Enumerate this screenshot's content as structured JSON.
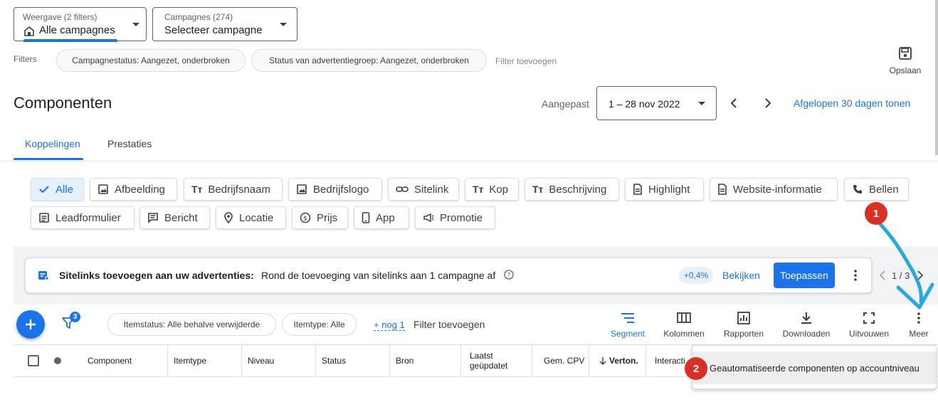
{
  "view_select": {
    "label": "Weergave (2 filters)",
    "value": "Alle campagnes"
  },
  "campaign_select": {
    "label": "Campagnes (274)",
    "value": "Selecteer campagne"
  },
  "filters": {
    "label": "Filters",
    "chips": [
      "Campagnestatus: Aangezet, onderbroken",
      "Status van advertentiegroep: Aangezet, onderbroken"
    ],
    "add": "Filter toevoegen"
  },
  "save_label": "Opslaan",
  "page_title": "Componenten",
  "date": {
    "label": "Aangepast",
    "range": "1 – 28 nov 2022",
    "show_30": "Afgelopen 30 dagen tonen"
  },
  "tabs": [
    "Koppelingen",
    "Prestaties"
  ],
  "asset_types": [
    "Alle",
    "Afbeelding",
    "Bedrijfsnaam",
    "Bedrijfslogo",
    "Sitelink",
    "Kop",
    "Beschrijving",
    "Highlight",
    "Website-informatie",
    "Bellen",
    "Leadformulier",
    "Bericht",
    "Locatie",
    "Prijs",
    "App",
    "Promotie"
  ],
  "recommendation": {
    "title": "Sitelinks toevoegen aan uw advertenties:",
    "text": "Rond de toevoeging van sitelinks aan 1 campagne af",
    "uplift": "+0,4%",
    "view": "Bekijken",
    "apply": "Toepassen",
    "pager": "1 / 3"
  },
  "table_toolbar": {
    "filter_count": "3",
    "chips": [
      "Itemstatus: Alle behalve verwijderde",
      "Itemtype: Alle"
    ],
    "more_link": "+ nog 1",
    "add_filter": "Filter toevoegen",
    "actions": [
      "Segment",
      "Kolommen",
      "Rapporten",
      "Downloaden",
      "Uitvouwen",
      "Meer"
    ]
  },
  "columns": [
    "Component",
    "Itemtype",
    "Niveau",
    "Status",
    "Bron",
    "Laatst geüpdatet",
    "Gem. CPV",
    "Verton.",
    "Interacti"
  ],
  "more_menu": {
    "item": "Geautomatiseerde componenten op accountniveau"
  },
  "annotations": [
    "1",
    "2"
  ],
  "colors": {
    "accent": "#1a73e8",
    "marker": "#d93025",
    "arrow": "#29a8dd"
  }
}
